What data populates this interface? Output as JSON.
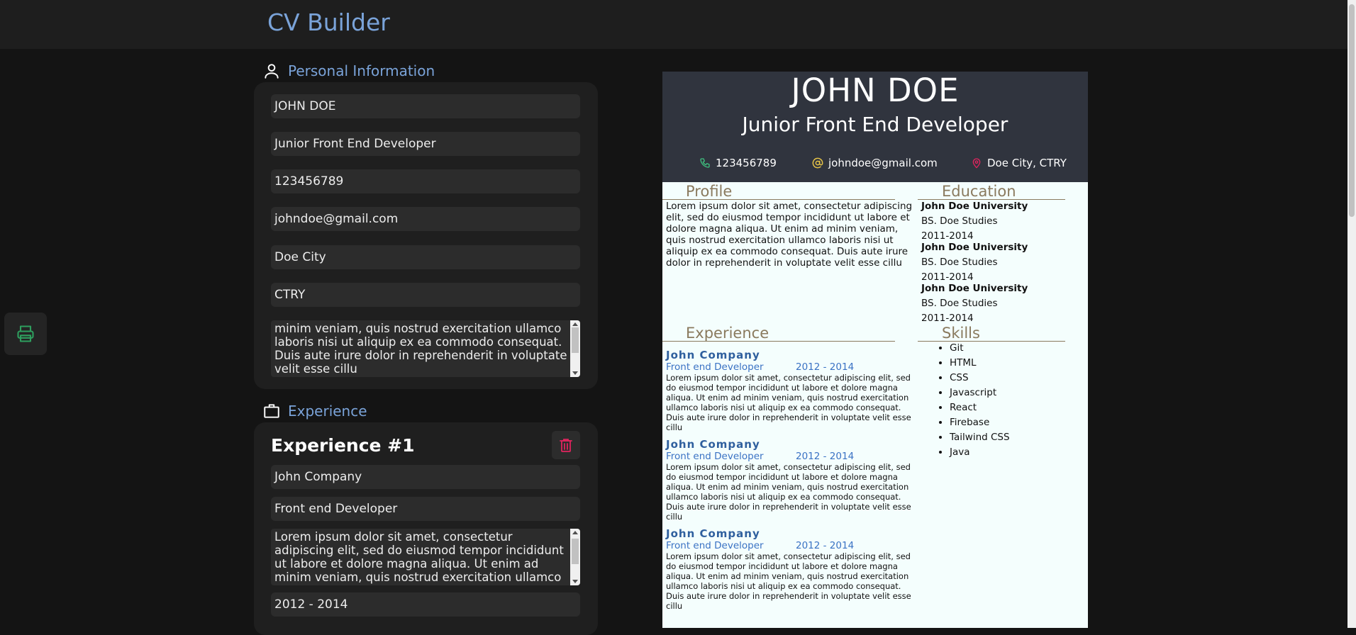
{
  "app": {
    "title": "CV Builder"
  },
  "personal": {
    "heading": "Personal Information",
    "name": "JOHN DOE",
    "title": "Junior Front End Developer",
    "phone": "123456789",
    "email": "johndoe@gmail.com",
    "city": "Doe City",
    "country": "CTRY",
    "profile_lines": [
      "minim veniam, quis nostrud exercitation ullamco",
      "laboris nisi ut aliquip ex ea commodo consequat.",
      "Duis aute irure dolor in reprehenderit in voluptate",
      "velit esse cillu"
    ]
  },
  "experience_form": {
    "heading": "Experience",
    "entry_title": "Experience #1",
    "company": "John Company",
    "position": "Front end Developer",
    "desc_lines": [
      "Lorem ipsum dolor sit amet, consectetur",
      "adipiscing elit, sed do eiusmod tempor incididunt",
      "ut labore et dolore magna aliqua. Ut enim ad",
      "minim veniam, quis nostrud exercitation ullamco"
    ],
    "period": "2012 - 2014"
  },
  "cv": {
    "name": "JOHN DOE",
    "title": "Junior Front End Developer",
    "phone": "123456789",
    "email": "johndoe@gmail.com",
    "location": "Doe City, CTRY",
    "profile_heading": "Profile",
    "profile_text": "Lorem ipsum dolor sit amet, consectetur adipiscing elit, sed do eiusmod tempor incididunt ut labore et dolore magna aliqua. Ut enim ad minim veniam, quis nostrud exercitation ullamco laboris nisi ut aliquip ex ea commodo consequat. Duis aute irure dolor in reprehenderit in voluptate velit esse cillu",
    "education_heading": "Education",
    "education": [
      {
        "school": "John Doe University",
        "degree": "BS. Doe Studies",
        "years": "2011-2014"
      },
      {
        "school": "John Doe University",
        "degree": "BS. Doe Studies",
        "years": "2011-2014"
      },
      {
        "school": "John Doe University",
        "degree": "BS. Doe Studies",
        "years": "2011-2014"
      }
    ],
    "experience_heading": "Experience",
    "experience": [
      {
        "company": "John Company",
        "position": "Front end Developer",
        "period": "2012 - 2014",
        "description": "Lorem ipsum dolor sit amet, consectetur adipiscing elit, sed do eiusmod tempor incididunt ut labore et dolore magna aliqua. Ut enim ad minim veniam, quis nostrud exercitation ullamco laboris nisi ut aliquip ex ea commodo consequat. Duis aute irure dolor in reprehenderit in voluptate velit esse cillu"
      },
      {
        "company": "John Company",
        "position": "Front end Developer",
        "period": "2012 - 2014",
        "description": "Lorem ipsum dolor sit amet, consectetur adipiscing elit, sed do eiusmod tempor incididunt ut labore et dolore magna aliqua. Ut enim ad minim veniam, quis nostrud exercitation ullamco laboris nisi ut aliquip ex ea commodo consequat. Duis aute irure dolor in reprehenderit in voluptate velit esse cillu"
      },
      {
        "company": "John Company",
        "position": "Front end Developer",
        "period": "2012 - 2014",
        "description": "Lorem ipsum dolor sit amet, consectetur adipiscing elit, sed do eiusmod tempor incididunt ut labore et dolore magna aliqua. Ut enim ad minim veniam, quis nostrud exercitation ullamco laboris nisi ut aliquip ex ea commodo consequat. Duis aute irure dolor in reprehenderit in voluptate velit esse cillu"
      }
    ],
    "skills_heading": "Skills",
    "skills": [
      "Git",
      "HTML",
      "CSS",
      "Javascript",
      "React",
      "Firebase",
      "Tailwind CSS",
      "Java"
    ]
  },
  "colors": {
    "accent": "#7aa3d9",
    "print_icon": "#2e9e5e",
    "trash_icon": "#e0245e",
    "cv_header": "#30343e",
    "cv_section": "#8a7a5e",
    "cv_company": "#2f5f9e"
  },
  "icons": {
    "print": "printer-icon",
    "person": "person-icon",
    "briefcase": "briefcase-icon",
    "trash": "trash-icon",
    "phone": "phone-icon",
    "email": "at-icon",
    "location": "location-pin-icon"
  }
}
